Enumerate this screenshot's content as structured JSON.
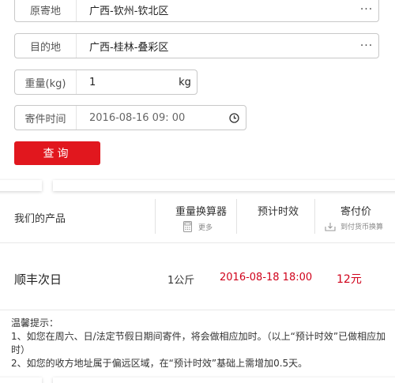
{
  "form": {
    "origin": {
      "label": "原寄地",
      "value": "广西-钦州-钦北区"
    },
    "destination": {
      "label": "目的地",
      "value": "广西-桂林-叠彩区"
    },
    "weight": {
      "label": "重量(kg)",
      "value": "1",
      "unit": "kg"
    },
    "send_time": {
      "label": "寄件时间",
      "value": "2016-08-16 09: 00"
    },
    "query_label": "查询",
    "more_icon": "ellipsis-icon",
    "clock_icon": "clock-icon"
  },
  "products_header": {
    "title": "我们的产品",
    "weight_calc": "重量换算器",
    "more": "更多",
    "eta": "预计时效",
    "price": "寄付价",
    "currency_convert": "到付货币换算",
    "calc_icon": "calculator-icon",
    "convert_icon": "currency-convert-icon"
  },
  "products": [
    {
      "name": "顺丰次日",
      "weight": "1公斤",
      "eta": "2016-08-18 18:00",
      "price": "12元"
    }
  ],
  "tips": {
    "title": "温馨提示：",
    "line1": "1、如您在周六、日/法定节假日期间寄件，将会做相应加时。（以上“预计时效”已做相应加时）",
    "line2": "2、如您的收方地址属于偏远区域，在“预计时效”基础上需增加0.5天。"
  },
  "colors": {
    "accent": "#e1171e",
    "highlight": "#d0021b"
  }
}
